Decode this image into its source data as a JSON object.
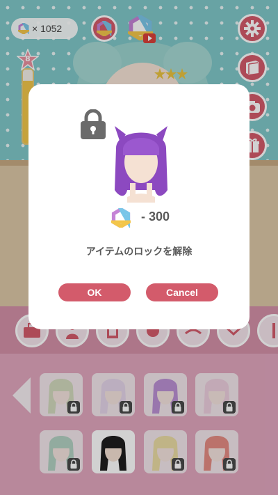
{
  "top_bar": {
    "gem_count": "× 1052"
  },
  "level": {
    "value": "8",
    "fill_fraction": 0.85
  },
  "side_buttons": [
    "gear-icon",
    "book-icon",
    "camera-icon",
    "gift-icon"
  ],
  "categories": [
    "bag-icon",
    "body-icon",
    "shirt-icon",
    "dot-icon",
    "eyebrow-icon",
    "mouth-icon",
    "more-icon"
  ],
  "dialog": {
    "cost": "- 300",
    "message": "アイテムのロックを解除",
    "ok_label": "OK",
    "cancel_label": "Cancel"
  },
  "items": [
    {
      "hair_color": "#b7cf98",
      "locked": true,
      "selected": false
    },
    {
      "hair_color": "#d8c7e8",
      "locked": true,
      "selected": false
    },
    {
      "hair_color": "#8c49c0",
      "locked": true,
      "selected": false
    },
    {
      "hair_color": "#e8bcd6",
      "locked": true,
      "selected": false
    },
    {
      "hair_color": "#7fbfa0",
      "locked": true,
      "selected": false
    },
    {
      "hair_color": "#1e1e1e",
      "locked": false,
      "selected": true
    },
    {
      "hair_color": "#e4d36a",
      "locked": true,
      "selected": false
    },
    {
      "hair_color": "#d8402f",
      "locked": true,
      "selected": false
    }
  ],
  "colors": {
    "accent": "#d35b6b",
    "wall": "#7fc7c9",
    "panel": "#e1a6be"
  }
}
